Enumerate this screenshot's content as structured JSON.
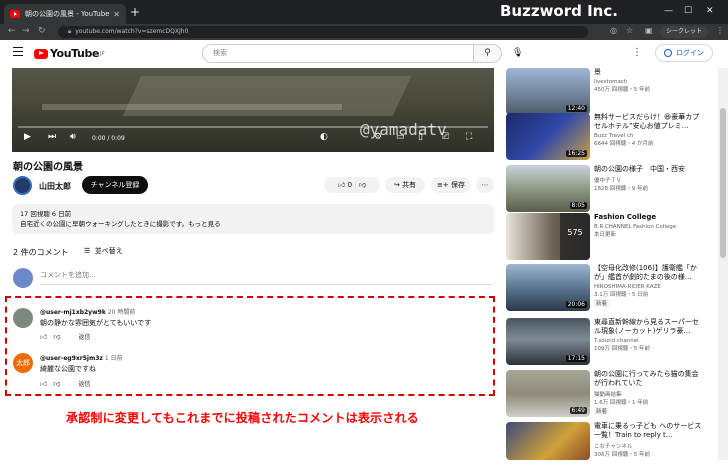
{
  "browser": {
    "tab_title": "朝の公園の風景 - YouTube",
    "tab_close": "✕",
    "new_tab": "+",
    "brand": "Buzzword Inc.",
    "url": "youtube.com/watch?v=szemcDQXJh0",
    "incognito_label": "シークレット",
    "win_min": "—",
    "win_max": "☐",
    "win_close": "✕"
  },
  "header": {
    "logo_text": "YouTube",
    "logo_region": "JP",
    "search_placeholder": "検索",
    "login_label": "ログイン"
  },
  "player": {
    "time": "0:00 / 0:09",
    "watermark": "@yamadatv",
    "progress": 0.0
  },
  "video": {
    "title": "朝の公園の風景",
    "channel": "山田太郎",
    "subscribe_label": "チャンネル登録",
    "like_count": "0",
    "share_label": "共有",
    "save_label": "保存",
    "description_stats": "17 回視聴  6 日前",
    "description_text": "自宅近くの公園に早朝ウォーキングしたときに撮影です。もっと見る"
  },
  "comments": {
    "count_label": "2 件のコメント",
    "sort_label": "並べ替え",
    "add_placeholder": "コメントを追加...",
    "reply_label": "返信",
    "items": [
      {
        "user": "@user-mj1xb2yw9k",
        "time": "20 時間前",
        "text": "朝の静かな雰囲気がとてもいいです",
        "avatar_color": "#7a8a7e"
      },
      {
        "user": "@user-eg9xr5jm3z",
        "time": "1 日前",
        "text": "綺麗な公園ですね",
        "avatar_color": "#ef6c00",
        "avatar_text": "太郎"
      }
    ]
  },
  "annotation": {
    "caption": "承認制に変更してもこれまでに投稿されたコメントは表示される"
  },
  "sidebar": {
    "items": [
      {
        "title": "景",
        "channel": "livestomach",
        "stats": "450万 回視聴・5 年前",
        "duration": "12:40",
        "badge": ""
      },
      {
        "title": "無料サービスだらけ！😆豪華カプセルホテル”安心お値プレミ…",
        "channel": "Buzz Travel ch",
        "stats": "6644 回視聴・4 か月前",
        "duration": "16:25",
        "badge": ""
      },
      {
        "title": "朝の公園の様子　中国・西安",
        "channel": "優中子ＴＶ",
        "stats": "1828 回視聴・9 年前",
        "duration": "8:05",
        "badge": ""
      },
      {
        "title": "Fashion College",
        "channel": "B.R.CHANNEL Fashion College",
        "stats": "本日更新",
        "duration": "",
        "badge": "",
        "playlist_count": "575"
      },
      {
        "title": "【空母化改修(106)】護衛艦「かが」艦首が劇的たまの後の様…",
        "channel": "HIROSHIMA-RIDER KAZE",
        "stats": "3.1万 回視聴・5 日前",
        "duration": "20:06",
        "badge": "新着"
      },
      {
        "title": "東尋直新幹線から見るスーパーセル現象(ノーカット)ゲリラ豪…",
        "channel": "T.sound channel",
        "stats": "109万 回視聴・5 年前",
        "duration": "17:15",
        "badge": ""
      },
      {
        "title": "朝の公園に行ってみたら猫の集会が行われていた",
        "channel": "猫動画結集",
        "stats": "1.6万 回視聴・1 年前",
        "duration": "6:49",
        "badge": "新着"
      },
      {
        "title": "電車に乗るっ子ども へのサービス一覧！Train to reply t…",
        "channel": "こなチャンネル",
        "stats": "306万 回視聴・5 年前",
        "duration": "",
        "badge": ""
      }
    ]
  }
}
